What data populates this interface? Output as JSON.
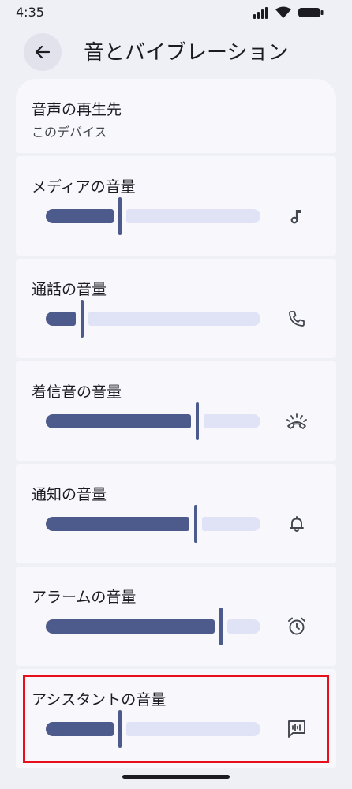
{
  "status_bar": {
    "time": "4:35"
  },
  "header": {
    "title": "音とバイブレーション"
  },
  "output": {
    "title": "音声の再生先",
    "subtitle": "このデバイス"
  },
  "volumes": [
    {
      "title": "メディアの音量",
      "level": 0.34,
      "icon": "music-note-icon"
    },
    {
      "title": "通話の音量",
      "level": 0.16,
      "icon": "phone-icon"
    },
    {
      "title": "着信音の音量",
      "level": 0.7,
      "icon": "ringing-phone-icon"
    },
    {
      "title": "通知の音量",
      "level": 0.69,
      "icon": "bell-icon"
    },
    {
      "title": "アラームの音量",
      "level": 0.81,
      "icon": "alarm-clock-icon"
    },
    {
      "title": "アシスタントの音量",
      "level": 0.34,
      "icon": "voice-chat-icon"
    }
  ],
  "colors": {
    "accent": "#4d5b8c",
    "track_inactive": "#dfe3f5",
    "highlight": "#e60f1b",
    "background": "#efeff6",
    "card": "#f7f7fc"
  }
}
